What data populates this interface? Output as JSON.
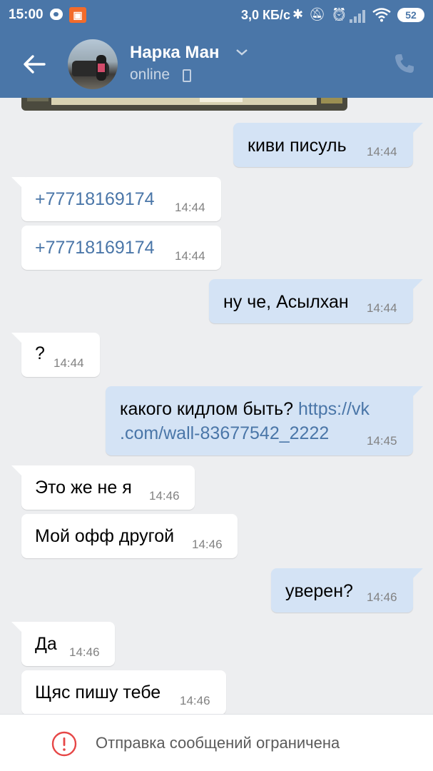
{
  "status_bar": {
    "time": "15:00",
    "speed": "3,0 КБ/с",
    "battery": "52"
  },
  "header": {
    "contact_name": "Нарка Ман",
    "status": "online",
    "accent_color": "#4a76a8"
  },
  "messages": [
    {
      "direction": "out",
      "text": "киви писуль",
      "time": "14:44"
    },
    {
      "direction": "in",
      "text": "+77718169174",
      "time": "14:44",
      "link": true
    },
    {
      "direction": "in",
      "text": "+77718169174",
      "time": "14:44",
      "link": true
    },
    {
      "direction": "out",
      "text": "ну че, Асылхан",
      "time": "14:44"
    },
    {
      "direction": "in",
      "text": "?",
      "time": "14:44"
    },
    {
      "direction": "out",
      "text": "какого кидлом быть?",
      "link_line1": "https://vk",
      "link_line2": ".com/wall-83677542_2222",
      "time": "14:45"
    },
    {
      "direction": "in",
      "text": "Это же не я",
      "time": "14:46"
    },
    {
      "direction": "in",
      "text": "Мой офф другой",
      "time": "14:46"
    },
    {
      "direction": "out",
      "text": "уверен?",
      "time": "14:46"
    },
    {
      "direction": "in",
      "text": "Да",
      "time": "14:46"
    },
    {
      "direction": "in",
      "text": "Щяс пишу тебе",
      "time": "14:46"
    }
  ],
  "bottom_bar": {
    "notice": "Отправка сообщений ограничена",
    "icon": "exclamation-circle-icon",
    "icon_color": "#e64646"
  }
}
